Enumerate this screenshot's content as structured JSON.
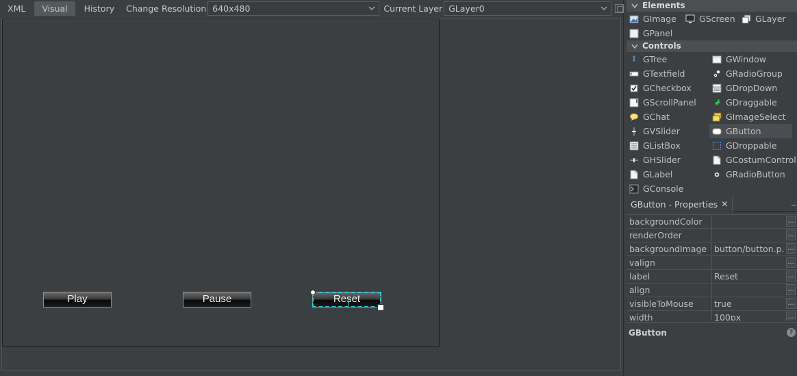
{
  "toolbar": {
    "tabs": [
      "XML",
      "Visual",
      "History"
    ],
    "active_tab": "Visual",
    "resolution_label": "Change Resolution",
    "resolution_value": "640x480",
    "layer_label": "Current Layer",
    "layer_value": "GLayer0"
  },
  "stage": {
    "buttons": {
      "play": "Play",
      "pause": "Pause",
      "reset": "Reset"
    },
    "selection_color": "#2cc7d6"
  },
  "palette": {
    "elements": {
      "title": "Elements",
      "items": [
        {
          "label": "GImage",
          "icon": "image-icon"
        },
        {
          "label": "GScreen",
          "icon": "screen-icon"
        },
        {
          "label": "GLayer",
          "icon": "layer-icon"
        },
        {
          "label": "GPanel",
          "icon": "panel-icon"
        }
      ]
    },
    "controls": {
      "title": "Controls",
      "items": [
        {
          "label": "GTree",
          "icon": "tree-icon"
        },
        {
          "label": "GWindow",
          "icon": "window-icon"
        },
        {
          "label": "GTextfield",
          "icon": "textfield-icon"
        },
        {
          "label": "GRadioGroup",
          "icon": "radiogroup-icon"
        },
        {
          "label": "GCheckbox",
          "icon": "checkbox-icon"
        },
        {
          "label": "GDropDown",
          "icon": "dropdown-icon"
        },
        {
          "label": "GScrollPanel",
          "icon": "scrollpanel-icon"
        },
        {
          "label": "GDraggable",
          "icon": "draggable-icon"
        },
        {
          "label": "GChat",
          "icon": "chat-icon"
        },
        {
          "label": "GImageSelect",
          "icon": "imageselect-icon"
        },
        {
          "label": "GVSlider",
          "icon": "vslider-icon"
        },
        {
          "label": "GButton",
          "icon": "button-icon"
        },
        {
          "label": "GListBox",
          "icon": "listbox-icon"
        },
        {
          "label": "GDroppable",
          "icon": "droppable-icon"
        },
        {
          "label": "GHSlider",
          "icon": "hslider-icon"
        },
        {
          "label": "GCostumControl",
          "icon": "customcontrol-icon"
        },
        {
          "label": "GLabel",
          "icon": "label-icon"
        },
        {
          "label": "GRadioButton",
          "icon": "radiobutton-icon"
        },
        {
          "label": "GConsole",
          "icon": "console-icon"
        }
      ],
      "selected": "GButton"
    }
  },
  "properties": {
    "tab_title": "GButton - Properties",
    "close_glyph": "✕",
    "rows": [
      {
        "key": "backgroundColor",
        "value": ""
      },
      {
        "key": "renderOrder",
        "value": ""
      },
      {
        "key": "backgroundImage",
        "value": "button/button.p..."
      },
      {
        "key": "valign",
        "value": ""
      },
      {
        "key": "label",
        "value": "Reset"
      },
      {
        "key": "align",
        "value": ""
      },
      {
        "key": "visibleToMouse",
        "value": "true"
      },
      {
        "key": "width",
        "value": "100px"
      }
    ],
    "dots": "...",
    "description_title": "GButton",
    "help_glyph": "?"
  }
}
